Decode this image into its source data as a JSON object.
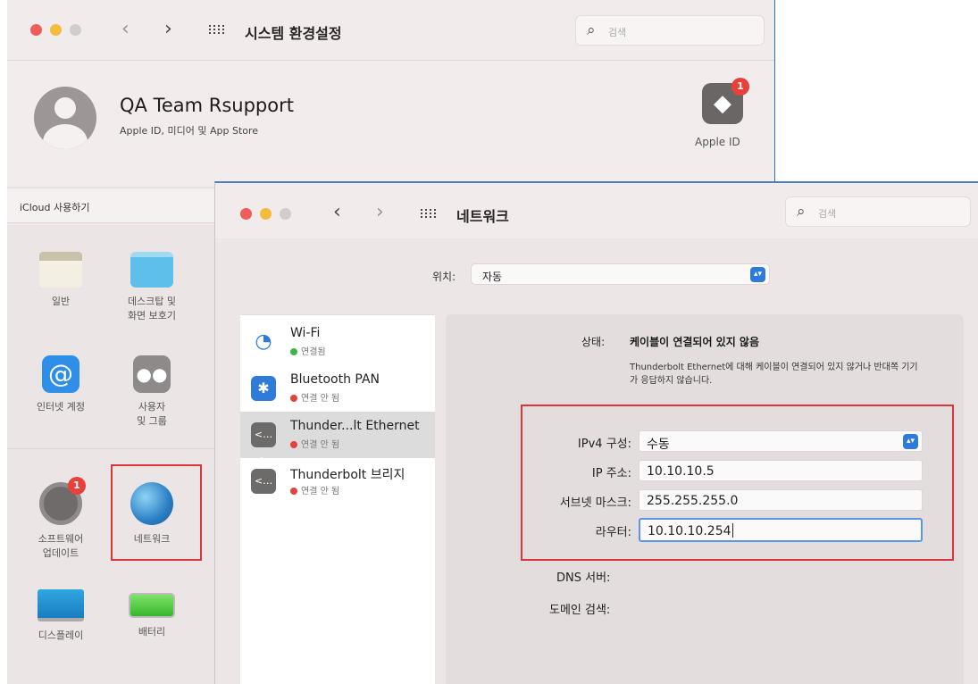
{
  "back_window": {
    "title": "시스템 환경설정",
    "search_placeholder": "검색",
    "account": {
      "name": "QA Team Rsupport",
      "subtitle": "Apple ID, 미디어 및 App Store"
    },
    "apple_id": {
      "label": "Apple ID",
      "badge": "1"
    },
    "icloud_bar": "iCloud 사용하기",
    "prefs": [
      {
        "label": "일반",
        "icon": "general-icon"
      },
      {
        "label": "데스크탑 및\n화면 보호기",
        "icon": "desktop-screensaver-icon"
      },
      {
        "label": "인터넷 계정",
        "icon": "internet-accounts-icon"
      },
      {
        "label": "사용자\n및 그룹",
        "icon": "users-groups-icon"
      },
      {
        "label": "소프트웨어\n업데이트",
        "icon": "software-update-icon",
        "badge": "1"
      },
      {
        "label": "네트워크",
        "icon": "network-globe-icon"
      },
      {
        "label": "디스플레이",
        "icon": "display-icon"
      },
      {
        "label": "배터리",
        "icon": "battery-icon"
      }
    ]
  },
  "network_window": {
    "title": "네트워크",
    "search_placeholder": "검색",
    "location": {
      "label": "위치:",
      "value": "자동"
    },
    "services": [
      {
        "name": "Wi-Fi",
        "status": "연결됨",
        "status_color": "#3cb54a",
        "icon": "wifi-icon"
      },
      {
        "name": "Bluetooth PAN",
        "status": "연결 안 됨",
        "status_color": "#e0443c",
        "icon": "bluetooth-icon"
      },
      {
        "name": "Thunder...lt Ethernet",
        "status": "연결 안 됨",
        "status_color": "#e0443c",
        "icon": "ethernet-icon"
      },
      {
        "name": "Thunderbolt 브리지",
        "status": "연결 안 됨",
        "status_color": "#e0443c",
        "icon": "thunderbolt-bridge-icon"
      }
    ],
    "selected_service": "Thunder...lt Ethernet",
    "status": {
      "label": "상태:",
      "value": "케이블이 연결되어 있지 않음",
      "description": "Thunderbolt Ethernet에 대해 케이블이 연결되어 있지 않거나 반대쪽 기기가 응답하지 않습니다."
    },
    "ipv4": {
      "label": "IPv4 구성:",
      "value": "수동"
    },
    "ip_address": {
      "label": "IP 주소:",
      "value": "10.10.10.5"
    },
    "subnet": {
      "label": "서브넷 마스크:",
      "value": "255.255.255.0"
    },
    "router": {
      "label": "라우터:",
      "value": "10.10.10.254"
    },
    "dns": {
      "label": "DNS 서버:"
    },
    "search_domains": {
      "label": "도메인 검색:"
    }
  },
  "colors": {
    "highlight": "#d9353d",
    "accent": "#2f7bd9"
  }
}
